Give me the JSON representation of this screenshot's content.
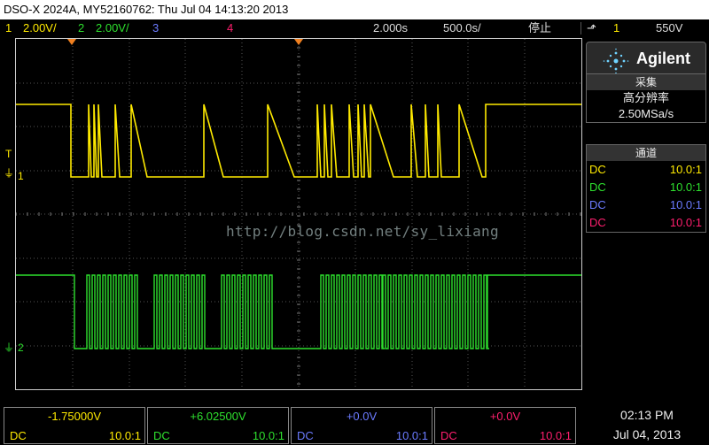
{
  "title": "DSO-X 2024A, MY52160762: Thu Jul 04 14:13:20 2013",
  "topbar": {
    "ch1_num": "1",
    "ch1_scale": "2.00V/",
    "ch2_num": "2",
    "ch2_scale": "2.00V/",
    "ch3_num": "3",
    "ch4_num": "4",
    "time_delay": "2.000s",
    "time_scale": "500.0s/",
    "run_state": "停止",
    "trig_slope": "⬏",
    "trig_ch": "1",
    "trig_level": "550V"
  },
  "side": {
    "brand": "Agilent",
    "acq_header": "采集",
    "acq_mode": "高分辨率",
    "acq_rate": "2.50MSa/s",
    "chan_header": "通道",
    "channels": [
      {
        "coupling": "DC",
        "probe": "10.0:1",
        "color": "#ffea00"
      },
      {
        "coupling": "DC",
        "probe": "10.0:1",
        "color": "#2ee02e"
      },
      {
        "coupling": "DC",
        "probe": "10.0:1",
        "color": "#6b7bff"
      },
      {
        "coupling": "DC",
        "probe": "10.0:1",
        "color": "#ff1f6e"
      }
    ]
  },
  "watermark": "http://blog.csdn.net/sy_lixiang",
  "markers": {
    "ch1": "1",
    "ch2": "2",
    "trig": "T"
  },
  "bottom": [
    {
      "offset": "-1.75000V",
      "coupling": "DC",
      "probe": "10.0:1"
    },
    {
      "offset": "+6.02500V",
      "coupling": "DC",
      "probe": "10.0:1"
    },
    {
      "offset": "+0.0V",
      "coupling": "DC",
      "probe": "10.0:1"
    },
    {
      "offset": "+0.0V",
      "coupling": "DC",
      "probe": "10.0:1"
    }
  ],
  "clock": {
    "time": "02:13 PM",
    "date": "Jul 04, 2013"
  },
  "colors": {
    "ch1": "#ffea00",
    "ch2": "#2ee02e",
    "ch3": "#6b7bff",
    "ch4": "#ff1f6e",
    "grid": "#555555"
  }
}
